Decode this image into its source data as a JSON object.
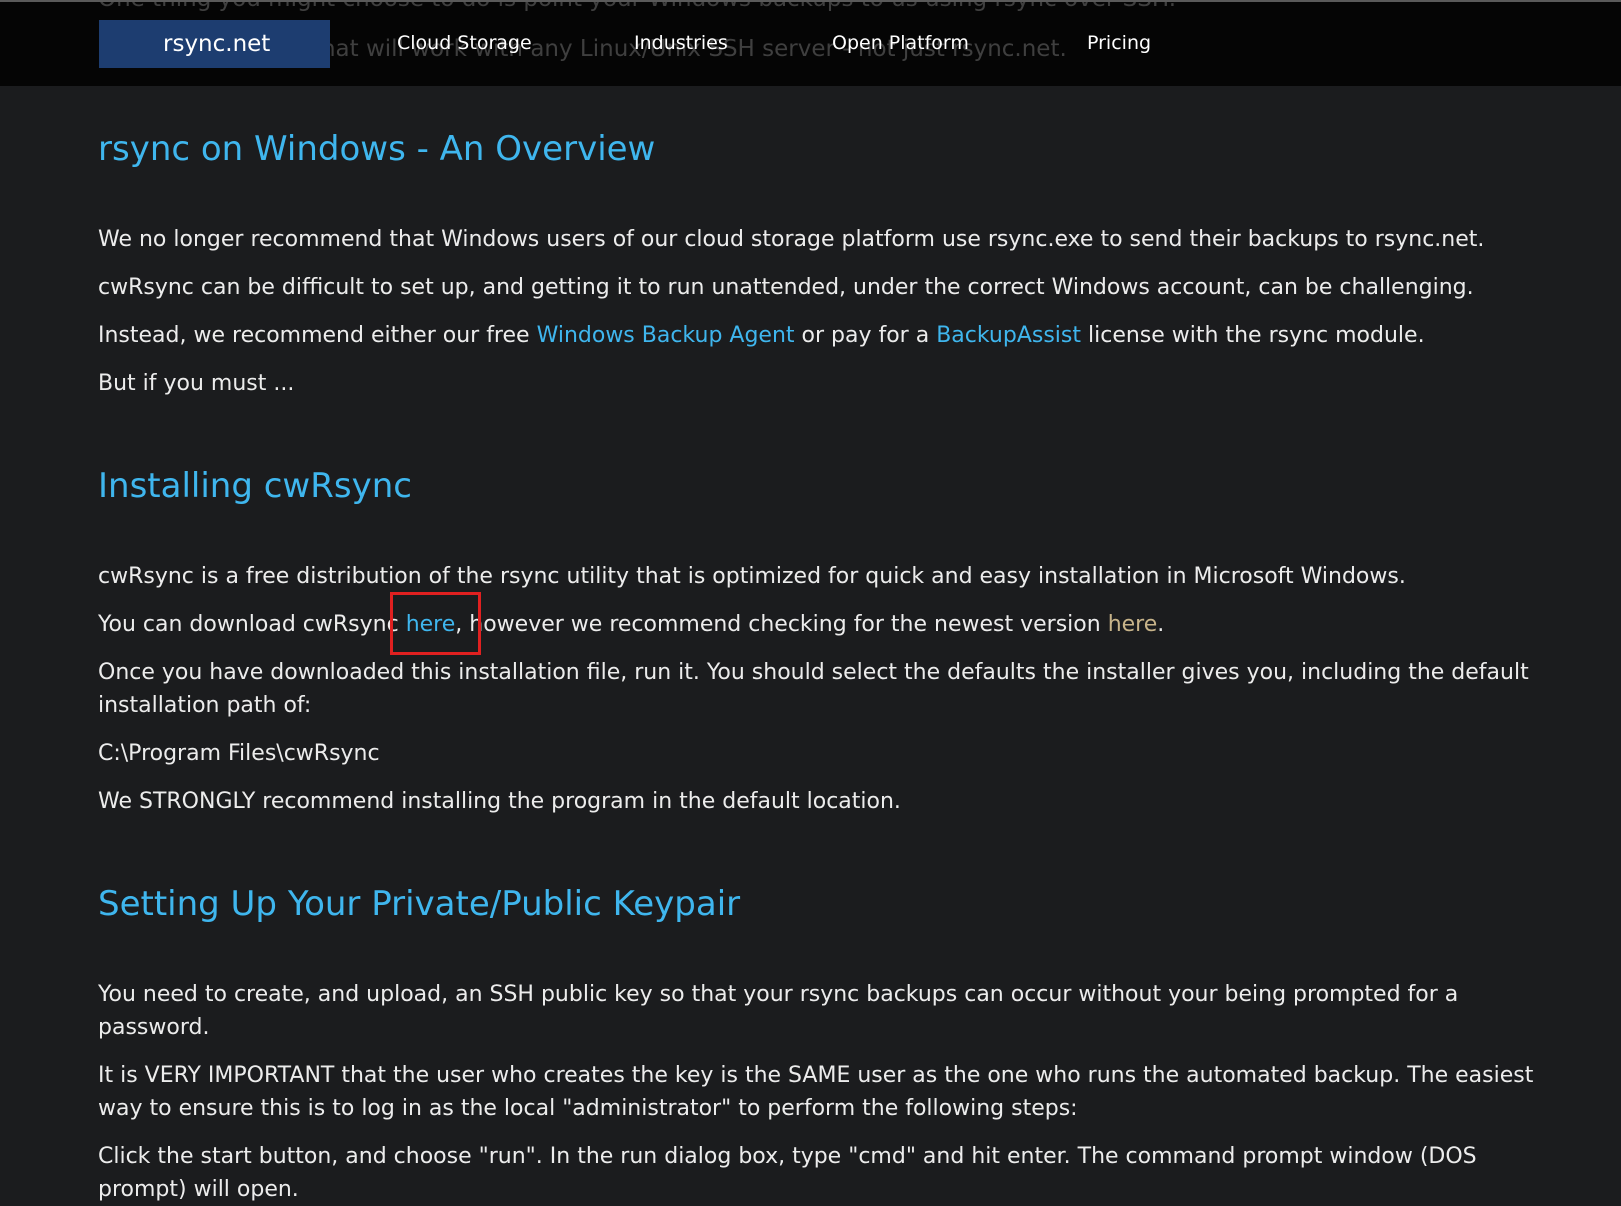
{
  "nav": {
    "ghost_line_1": "One thing you might choose to do is point your Windows backups to us using rsync over SSH.",
    "ghost_line_2": "Below is a tutorial that will work with any Linux/Unix SSH server - not just rsync.net.",
    "brand": "rsync.net",
    "items": [
      "Cloud Storage",
      "Industries",
      "Open Platform",
      "Pricing"
    ]
  },
  "overview": {
    "heading": "rsync on Windows - An Overview",
    "p1": "We no longer recommend that Windows users of our cloud storage platform use rsync.exe to send their backups to rsync.net.",
    "p2": "cwRsync can be difficult to set up, and getting it to run unattended, under the correct Windows account, can be challenging.",
    "p3_pre": "Instead, we recommend either our free ",
    "p3_link1": "Windows Backup Agent",
    "p3_mid": " or pay for a ",
    "p3_link2": "BackupAssist",
    "p3_post": " license with the rsync module.",
    "p4": "But if you must ..."
  },
  "install": {
    "heading": "Installing cwRsync",
    "p1": "cwRsync is a free distribution of the rsync utility that is optimized for quick and easy installation in Microsoft Windows.",
    "p2_pre": "You can download cwRsync ",
    "p2_link1": "here",
    "p2_mid": ", however we recommend checking for the newest version ",
    "p2_link2": "here",
    "p2_post": ".",
    "p3": "Once you have downloaded this installation file, run it. You should select the defaults the installer gives you, including the default installation path of:",
    "p4": "C:\\Program Files\\cwRsync",
    "p5": "We STRONGLY recommend installing the program in the default location."
  },
  "keypair": {
    "heading": "Setting Up Your Private/Public Keypair",
    "p1": "You need to create, and upload, an SSH public key so that your rsync backups can occur without your being prompted for a password.",
    "p2": "It is VERY IMPORTANT that the user who creates the key is the SAME user as the one who runs the automated backup. The easiest way to ensure this is to log in as the local \"administrator\" to perform the following steps:",
    "p3": "Click the start button, and choose \"run\". In the run dialog box, type \"cmd\" and hit enter. The command prompt window (DOS prompt) will open."
  },
  "colors": {
    "background": "#1b1c1e",
    "heading": "#3fb6ee",
    "link": "#3fb6ee",
    "visited_link": "#c8b48a",
    "highlight": "#e02020",
    "brand_bg": "#1d3d70"
  }
}
